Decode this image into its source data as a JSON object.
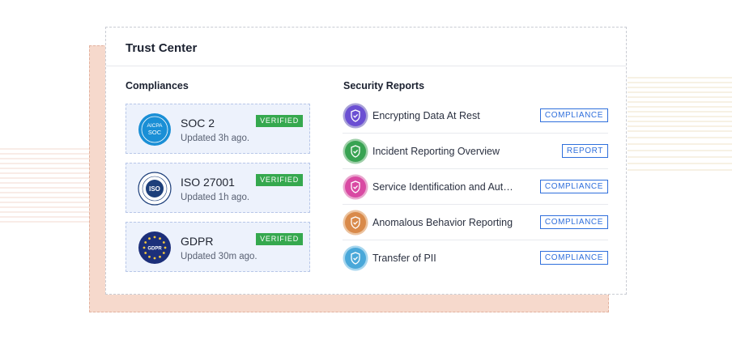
{
  "window": {
    "title": "Trust Center"
  },
  "compliances": {
    "heading": "Compliances",
    "items": [
      {
        "name": "SOC 2",
        "updated": "Updated 3h ago.",
        "badge": "VERIFIED",
        "logo_text": [
          "AICPA",
          "SOC"
        ]
      },
      {
        "name": "ISO 27001",
        "updated": "Updated 1h ago.",
        "badge": "VERIFIED",
        "logo_text": [
          "ISO"
        ]
      },
      {
        "name": "GDPR",
        "updated": "Updated 30m ago.",
        "badge": "VERIFIED",
        "logo_text": [
          "GDPR"
        ]
      }
    ]
  },
  "security_reports": {
    "heading": "Security Reports",
    "items": [
      {
        "name": "Encrypting Data At Rest",
        "tag": "COMPLIANCE",
        "icon": "shield-check-icon",
        "color": "#6b4fd3"
      },
      {
        "name": "Incident Reporting Overview",
        "tag": "REPORT",
        "icon": "shield-check-icon",
        "color": "#38a352"
      },
      {
        "name": "Service Identification and Authentication",
        "tag": "COMPLIANCE",
        "icon": "shield-check-icon",
        "color": "#d94aa3"
      },
      {
        "name": "Anomalous Behavior Reporting",
        "tag": "COMPLIANCE",
        "icon": "shield-check-icon",
        "color": "#d98a4a"
      },
      {
        "name": "Transfer of PII",
        "tag": "COMPLIANCE",
        "icon": "shield-check-icon",
        "color": "#4aa8d9"
      }
    ]
  },
  "colors": {
    "verified": "#35a84e",
    "tag_border": "#2f6fdc",
    "tile_bg": "#edf2fc",
    "backdrop": "#f6d9cc"
  }
}
